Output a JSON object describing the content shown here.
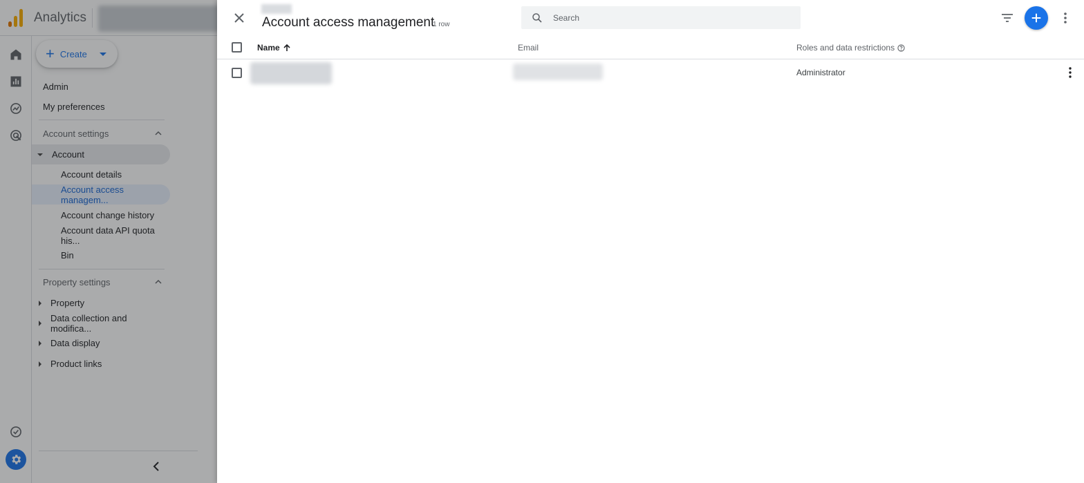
{
  "app": {
    "title": "Analytics",
    "brand_colors": [
      "#f9ab00",
      "#e37400"
    ]
  },
  "nav": {
    "create_label": "Create",
    "admin_label": "Admin",
    "preferences_label": "My preferences",
    "account_settings_label": "Account settings",
    "account_label": "Account",
    "account_items": [
      "Account details",
      "Account access managem...",
      "Account change history",
      "Account data API quota his...",
      "Bin"
    ],
    "property_settings_label": "Property settings",
    "property_items": [
      "Property",
      "Data collection and modifica...",
      "Data display",
      "Product links"
    ],
    "active_color": "#1a73e8"
  },
  "drawer": {
    "title": "Account access management",
    "row_count": "1 row",
    "search_placeholder": "Search",
    "columns": {
      "name": "Name",
      "email": "Email",
      "roles": "Roles and data restrictions"
    },
    "rows": [
      {
        "role": "Administrator"
      }
    ],
    "accent_color": "#1a73e8"
  }
}
